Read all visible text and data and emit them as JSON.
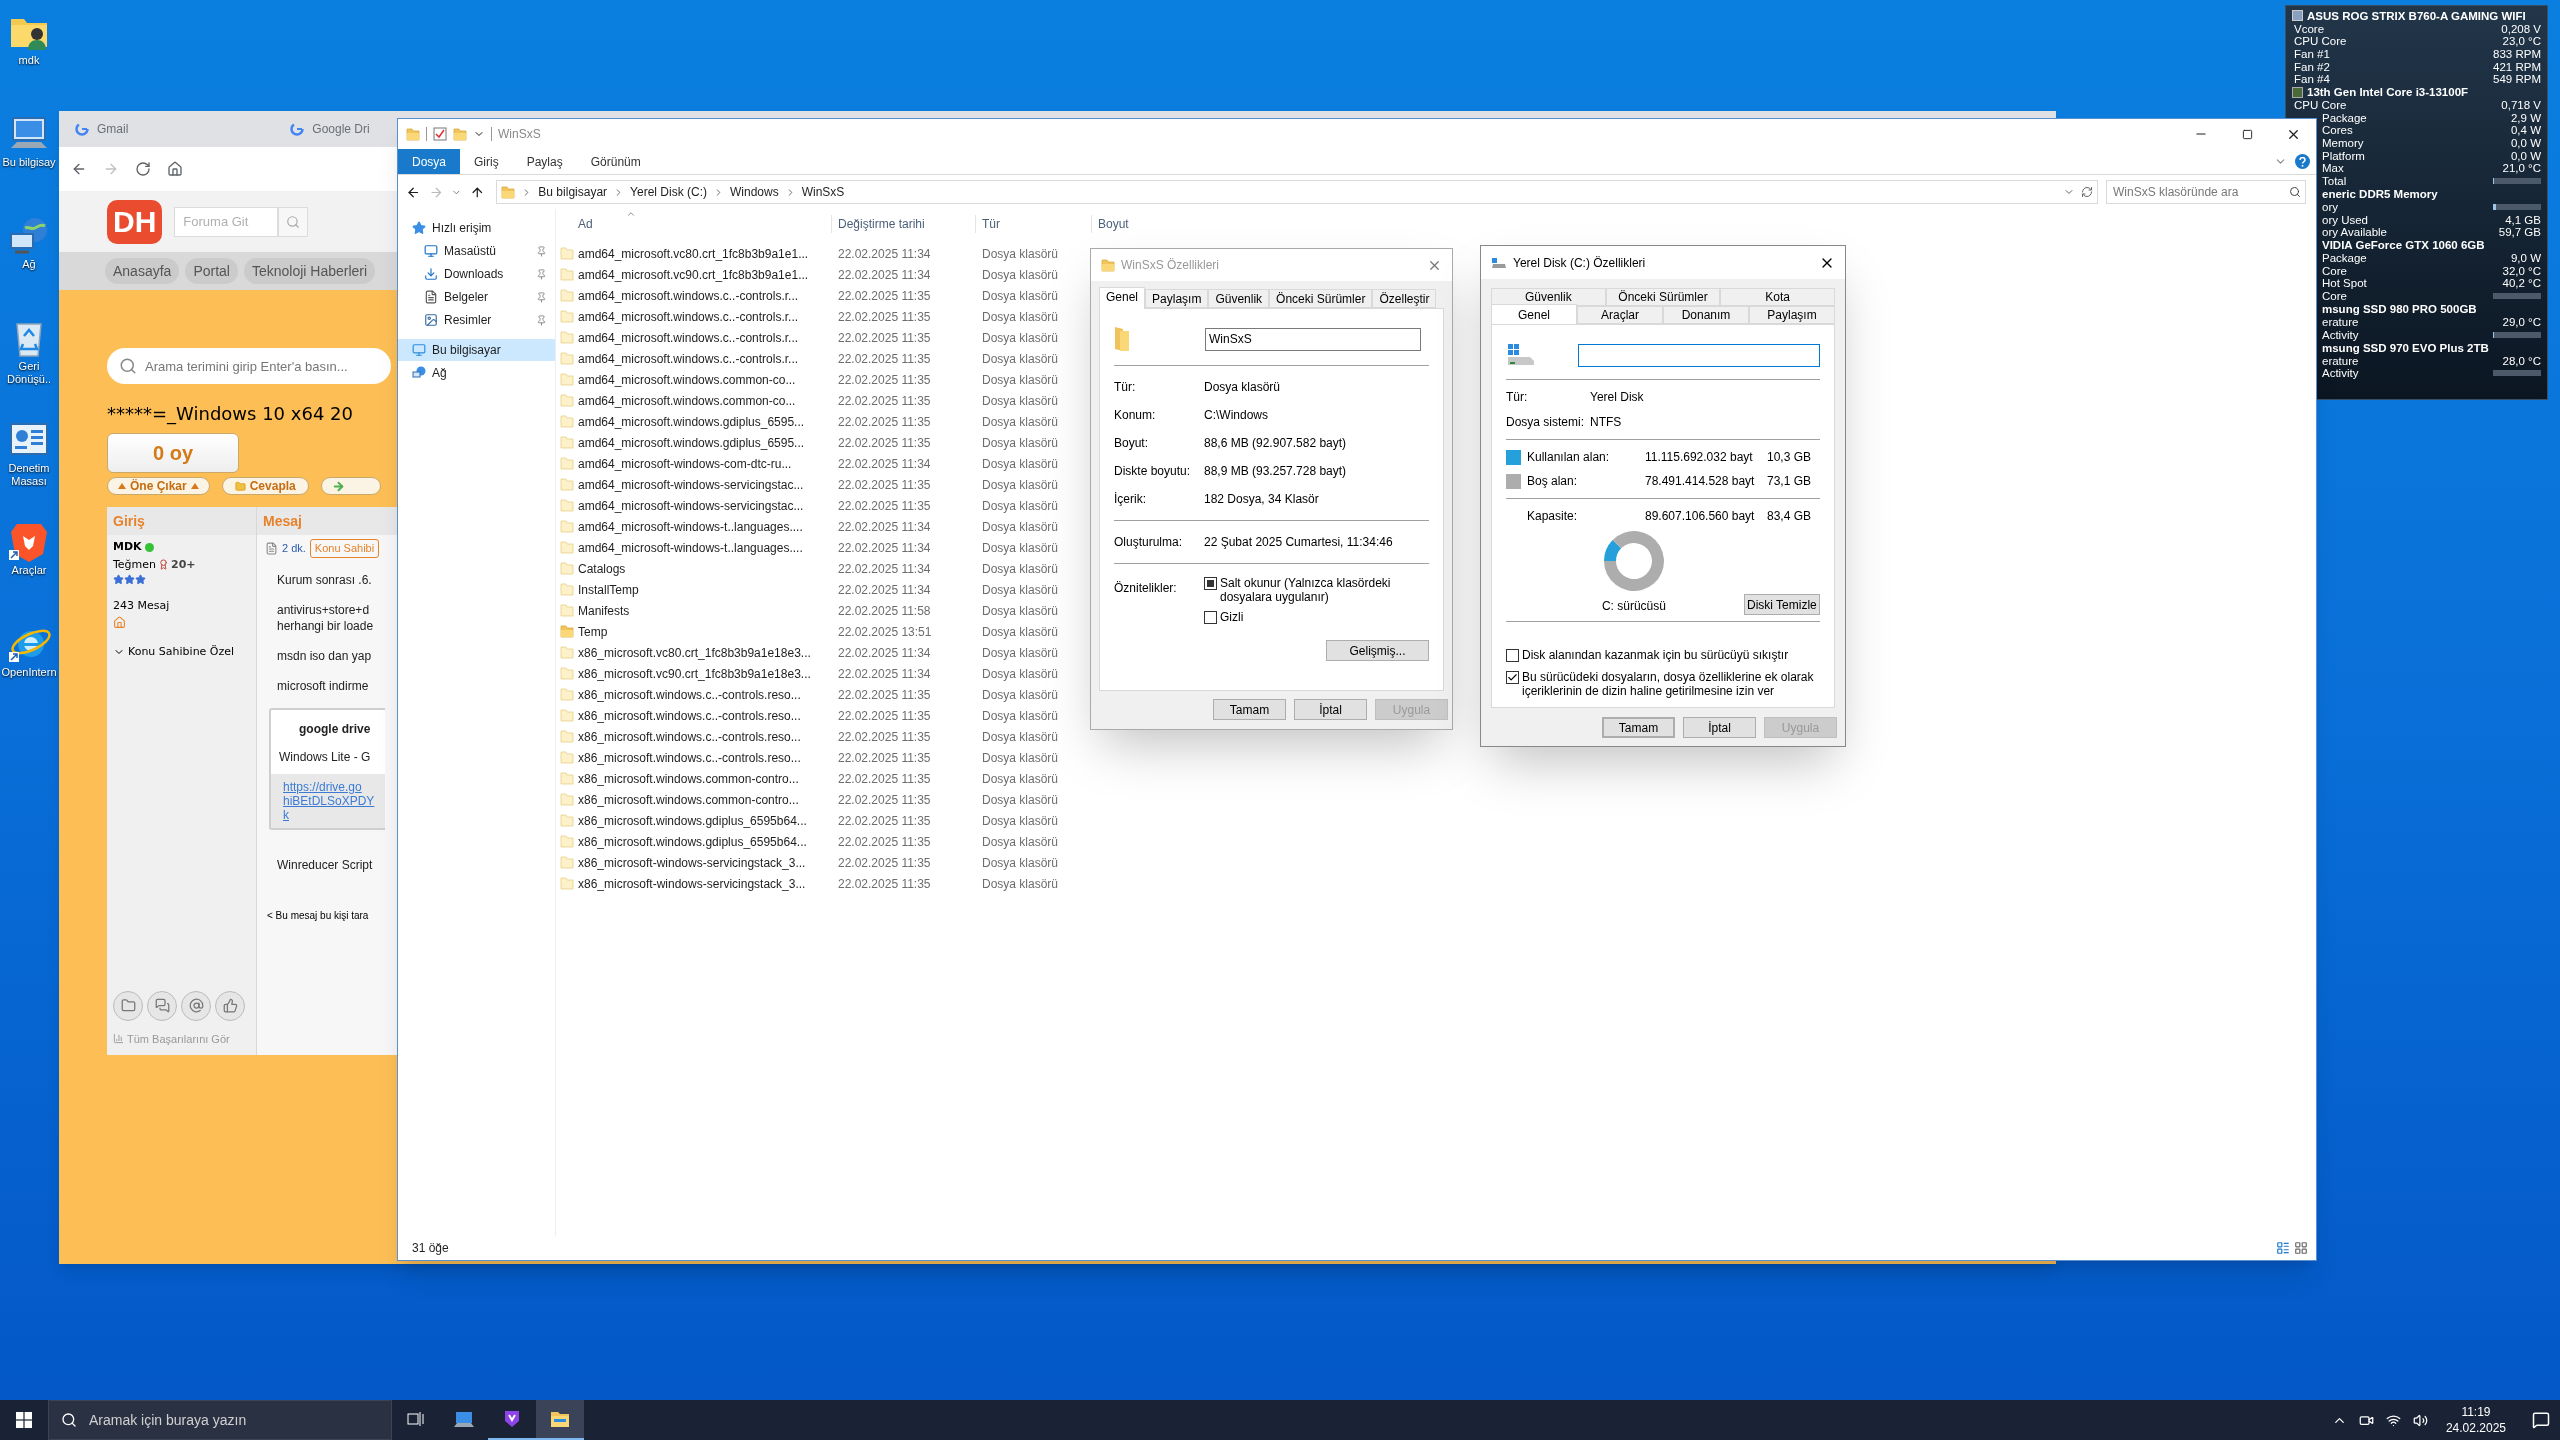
{
  "desktop_icons": [
    {
      "label": "mdk",
      "kind": "user-folder"
    },
    {
      "label": "Bu bilgisay",
      "kind": "computer"
    },
    {
      "label": "Ağ",
      "kind": "network"
    },
    {
      "label": "Geri Dönüşü..",
      "kind": "recycle"
    },
    {
      "label": "Denetim Masası",
      "kind": "control"
    },
    {
      "label": "Araçlar",
      "kind": "lion"
    },
    {
      "label": "OpenIntern",
      "kind": "globe-e"
    }
  ],
  "browser": {
    "tabs": [
      {
        "label": "Gmail"
      },
      {
        "label": "Google Dri"
      }
    ],
    "forum": {
      "logo": "DH",
      "search_placeholder": "Foruma Git",
      "nav": [
        "Anasayfa",
        "Portal",
        "Teknoloji Haberleri"
      ],
      "site_search_placeholder": "Arama terimini girip Enter'a basın...",
      "thread_title": "*****=_Windows 10 x64 20",
      "vote": "0 oy",
      "actions": [
        {
          "label": "Öne Çıkar",
          "kind": "promote"
        },
        {
          "label": "Cevapla",
          "kind": "reply"
        },
        {
          "kind": "forward"
        }
      ],
      "post": {
        "user_header": "Giriş",
        "message_header": "Mesaj",
        "user": {
          "name": "MDK",
          "online": true,
          "rank": "Teğmen",
          "rank_level": "20+",
          "stars": 3,
          "posts": "243 Mesaj",
          "menu": "Konu Sahibine Özel",
          "achievements": "Tüm Başarılarını Gör"
        },
        "message": {
          "time": "2 dk.",
          "badge": "Konu Sahibi",
          "paragraphs": [
            [
              "Kurum sonrası .6."
            ],
            [
              "antivirus+store+d",
              "herhangi bir loade"
            ],
            [
              "msdn iso dan yap"
            ],
            [
              "microsoft indirme"
            ]
          ],
          "quote": {
            "title": "google drive",
            "text": "Windows Lite - G",
            "link_lines": [
              "https://drive.go",
              "hiBEtDLSoXPDY",
              "k"
            ]
          },
          "after": "Winreducer Script",
          "footer": "< Bu mesaj bu kişi tara"
        }
      }
    }
  },
  "explorer": {
    "title": "WinSxS",
    "ribbon_tabs": [
      {
        "label": "Dosya",
        "selected": true
      },
      {
        "label": "Giriş",
        "selected": false
      },
      {
        "label": "Paylaş",
        "selected": false
      },
      {
        "label": "Görünüm",
        "selected": false
      }
    ],
    "path": [
      "Bu bilgisayar",
      "Yerel Disk (C:)",
      "Windows",
      "WinSxS"
    ],
    "search_placeholder": "WinSxS klasöründe ara",
    "nav": [
      {
        "label": "Hızlı erişim",
        "kind": "star",
        "selected": false,
        "children": [
          {
            "label": "Masaüstü",
            "kind": "desktop",
            "pinned": true,
            "selected": false
          },
          {
            "label": "Downloads",
            "kind": "download",
            "pinned": true,
            "selected": false
          },
          {
            "label": "Belgeler",
            "kind": "docs",
            "pinned": true,
            "selected": false
          },
          {
            "label": "Resimler",
            "kind": "pictures",
            "pinned": true,
            "selected": false
          }
        ]
      },
      {
        "label": "Bu bilgisayar",
        "kind": "pc",
        "selected": true
      },
      {
        "label": "Ağ",
        "kind": "network",
        "selected": false
      }
    ],
    "columns": [
      "Ad",
      "Değiştirme tarihi",
      "Tür",
      "Boyut"
    ],
    "rows": [
      {
        "name": "amd64_microsoft.vc80.crt_1fc8b3b9a1e1...",
        "date": "22.02.2025 11:34",
        "type": "Dosya klasörü",
        "kind": "empty-folder"
      },
      {
        "name": "amd64_microsoft.vc90.crt_1fc8b3b9a1e1...",
        "date": "22.02.2025 11:34",
        "type": "Dosya klasörü",
        "kind": "empty-folder"
      },
      {
        "name": "amd64_microsoft.windows.c..-controls.r...",
        "date": "22.02.2025 11:35",
        "type": "Dosya klasörü",
        "kind": "empty-folder"
      },
      {
        "name": "amd64_microsoft.windows.c..-controls.r...",
        "date": "22.02.2025 11:35",
        "type": "Dosya klasörü",
        "kind": "empty-folder"
      },
      {
        "name": "amd64_microsoft.windows.c..-controls.r...",
        "date": "22.02.2025 11:35",
        "type": "Dosya klasörü",
        "kind": "empty-folder"
      },
      {
        "name": "amd64_microsoft.windows.c..-controls.r...",
        "date": "22.02.2025 11:35",
        "type": "Dosya klasörü",
        "kind": "empty-folder"
      },
      {
        "name": "amd64_microsoft.windows.common-co...",
        "date": "22.02.2025 11:35",
        "type": "Dosya klasörü",
        "kind": "empty-folder"
      },
      {
        "name": "amd64_microsoft.windows.common-co...",
        "date": "22.02.2025 11:35",
        "type": "Dosya klasörü",
        "kind": "empty-folder"
      },
      {
        "name": "amd64_microsoft.windows.gdiplus_6595...",
        "date": "22.02.2025 11:35",
        "type": "Dosya klasörü",
        "kind": "empty-folder"
      },
      {
        "name": "amd64_microsoft.windows.gdiplus_6595...",
        "date": "22.02.2025 11:35",
        "type": "Dosya klasörü",
        "kind": "empty-folder"
      },
      {
        "name": "amd64_microsoft-windows-com-dtc-ru...",
        "date": "22.02.2025 11:34",
        "type": "Dosya klasörü",
        "kind": "empty-folder"
      },
      {
        "name": "amd64_microsoft-windows-servicingstac...",
        "date": "22.02.2025 11:35",
        "type": "Dosya klasörü",
        "kind": "empty-folder"
      },
      {
        "name": "amd64_microsoft-windows-servicingstac...",
        "date": "22.02.2025 11:35",
        "type": "Dosya klasörü",
        "kind": "empty-folder"
      },
      {
        "name": "amd64_microsoft-windows-t..languages....",
        "date": "22.02.2025 11:34",
        "type": "Dosya klasörü",
        "kind": "empty-folder"
      },
      {
        "name": "amd64_microsoft-windows-t..languages....",
        "date": "22.02.2025 11:34",
        "type": "Dosya klasörü",
        "kind": "empty-folder"
      },
      {
        "name": "Catalogs",
        "date": "22.02.2025 11:34",
        "type": "Dosya klasörü",
        "kind": "empty-folder"
      },
      {
        "name": "InstallTemp",
        "date": "22.02.2025 11:34",
        "type": "Dosya klasörü",
        "kind": "empty-folder"
      },
      {
        "name": "Manifests",
        "date": "22.02.2025 11:58",
        "type": "Dosya klasörü",
        "kind": "empty-folder"
      },
      {
        "name": "Temp",
        "date": "22.02.2025 13:51",
        "type": "Dosya klasörü",
        "kind": "folder"
      },
      {
        "name": "x86_microsoft.vc80.crt_1fc8b3b9a1e18e3...",
        "date": "22.02.2025 11:34",
        "type": "Dosya klasörü",
        "kind": "empty-folder"
      },
      {
        "name": "x86_microsoft.vc90.crt_1fc8b3b9a1e18e3...",
        "date": "22.02.2025 11:34",
        "type": "Dosya klasörü",
        "kind": "empty-folder"
      },
      {
        "name": "x86_microsoft.windows.c..-controls.reso...",
        "date": "22.02.2025 11:35",
        "type": "Dosya klasörü",
        "kind": "empty-folder"
      },
      {
        "name": "x86_microsoft.windows.c..-controls.reso...",
        "date": "22.02.2025 11:35",
        "type": "Dosya klasörü",
        "kind": "empty-folder"
      },
      {
        "name": "x86_microsoft.windows.c..-controls.reso...",
        "date": "22.02.2025 11:35",
        "type": "Dosya klasörü",
        "kind": "empty-folder"
      },
      {
        "name": "x86_microsoft.windows.c..-controls.reso...",
        "date": "22.02.2025 11:35",
        "type": "Dosya klasörü",
        "kind": "empty-folder"
      },
      {
        "name": "x86_microsoft.windows.common-contro...",
        "date": "22.02.2025 11:35",
        "type": "Dosya klasörü",
        "kind": "empty-folder"
      },
      {
        "name": "x86_microsoft.windows.common-contro...",
        "date": "22.02.2025 11:35",
        "type": "Dosya klasörü",
        "kind": "empty-folder"
      },
      {
        "name": "x86_microsoft.windows.gdiplus_6595b64...",
        "date": "22.02.2025 11:35",
        "type": "Dosya klasörü",
        "kind": "empty-folder"
      },
      {
        "name": "x86_microsoft.windows.gdiplus_6595b64...",
        "date": "22.02.2025 11:35",
        "type": "Dosya klasörü",
        "kind": "empty-folder"
      },
      {
        "name": "x86_microsoft-windows-servicingstack_3...",
        "date": "22.02.2025 11:35",
        "type": "Dosya klasörü",
        "kind": "empty-folder"
      },
      {
        "name": "x86_microsoft-windows-servicingstack_3...",
        "date": "22.02.2025 11:35",
        "type": "Dosya klasörü",
        "kind": "empty-folder"
      }
    ],
    "status": "31 öğe"
  },
  "folder_dialog": {
    "title": "WinSxS Özellikleri",
    "active": false,
    "tabs": [
      {
        "label": "Genel",
        "selected": true
      },
      {
        "label": "Paylaşım",
        "selected": false
      },
      {
        "label": "Güvenlik",
        "selected": false
      },
      {
        "label": "Önceki Sürümler",
        "selected": false
      },
      {
        "label": "Özelleştir",
        "selected": false
      }
    ],
    "name_value": "WinSxS",
    "groups": [
      [
        {
          "label": "Tür:",
          "value": "Dosya klasörü"
        },
        {
          "label": "Konum:",
          "value": "C:\\Windows"
        },
        {
          "label": "Boyut:",
          "value": "88,6 MB (92.907.582 bayt)"
        },
        {
          "label": "Diskte boyutu:",
          "value": "88,9 MB (93.257.728 bayt)"
        },
        {
          "label": "İçerik:",
          "value": "182 Dosya, 34 Klasör"
        }
      ],
      [
        {
          "label": "Oluşturulma:",
          "value": "22 Şubat 2025 Cumartesi, 11:34:46"
        }
      ]
    ],
    "attributes_label": "Öznitelikler:",
    "attributes": [
      {
        "label": "Salt okunur (Yalnızca klasördeki dosyalara uygulanır)",
        "checked": false,
        "indeterminate": true
      },
      {
        "label": "Gizli",
        "checked": false,
        "indeterminate": false
      }
    ],
    "advanced_button": "Gelişmiş...",
    "buttons": [
      {
        "label": "Tamam",
        "disabled": false,
        "default": false
      },
      {
        "label": "İptal",
        "disabled": false,
        "default": false
      },
      {
        "label": "Uygula",
        "disabled": true,
        "default": false
      }
    ]
  },
  "disk_dialog": {
    "title": "Yerel Disk (C:) Özellikleri",
    "active": true,
    "tab_rows": [
      [
        {
          "label": "Güvenlik",
          "selected": false
        },
        {
          "label": "Önceki Sürümler",
          "selected": false
        },
        {
          "label": "Kota",
          "selected": false
        }
      ],
      [
        {
          "label": "Genel",
          "selected": true
        },
        {
          "label": "Araçlar",
          "selected": false
        },
        {
          "label": "Donanım",
          "selected": false
        },
        {
          "label": "Paylaşım",
          "selected": false
        }
      ]
    ],
    "name_focused": true,
    "info": [
      {
        "label": "Tür:",
        "value": "Yerel Disk"
      },
      {
        "label": "Dosya sistemi:",
        "value": "NTFS"
      }
    ],
    "usage": [
      {
        "label": "Kullanılan alan:",
        "bytes": "11.115.692.032 bayt",
        "size": "10,3 GB",
        "color": "#26a0da"
      },
      {
        "label": "Boş alan:",
        "bytes": "78.491.414.528 bayt",
        "size": "73,1 GB",
        "color": "#adadad"
      }
    ],
    "capacity": {
      "label": "Kapasite:",
      "bytes": "89.607.106.560 bayt",
      "size": "83,4 GB"
    },
    "chart_data": {
      "type": "donut",
      "values": [
        12.4,
        87.6
      ]
    },
    "drive_label": "C: sürücüsü",
    "cleanup_button": "Diski Temizle",
    "options": [
      {
        "label": "Disk alanından kazanmak için bu sürücüyü sıkıştır",
        "checked": false
      },
      {
        "label": "Bu sürücüdeki dosyaların, dosya özelliklerine ek olarak içeriklerinin de dizin haline getirilmesine izin ver",
        "checked": true
      }
    ],
    "buttons": [
      {
        "label": "Tamam",
        "disabled": false,
        "default": true
      },
      {
        "label": "İptal",
        "disabled": false,
        "default": false
      },
      {
        "label": "Uygula",
        "disabled": true,
        "default": false
      }
    ]
  },
  "hwinfo": [
    {
      "title": "ASUS ROG STRIX B760-A GAMING WIFI",
      "cut": false,
      "kind": "board",
      "rows": [
        {
          "label": "Vcore",
          "value": "0,208 V",
          "cut": false,
          "kind": "value"
        },
        {
          "label": "CPU Core",
          "value": "23,0 °C",
          "cut": false,
          "kind": "value"
        },
        {
          "label": "Fan #1",
          "value": "833 RPM",
          "cut": false,
          "kind": "value"
        },
        {
          "label": "Fan #2",
          "value": "421 RPM",
          "cut": false,
          "kind": "value"
        },
        {
          "label": "Fan #4",
          "value": "549 RPM",
          "cut": false,
          "kind": "value"
        }
      ]
    },
    {
      "title": "13th Gen Intel Core i3-13100F",
      "cut": false,
      "kind": "chip",
      "rows": [
        {
          "label": "CPU Core",
          "value": "0,718 V",
          "cut": false,
          "kind": "value"
        },
        {
          "label": "Package",
          "value": "2,9 W",
          "cut": true,
          "kind": "value"
        },
        {
          "label": "Cores",
          "value": "0,4 W",
          "cut": true,
          "kind": "value"
        },
        {
          "label": "Memory",
          "value": "0,0 W",
          "cut": true,
          "kind": "value"
        },
        {
          "label": "Platform",
          "value": "0,0 W",
          "cut": true,
          "kind": "value"
        },
        {
          "label": "Max",
          "value": "21,0 °C",
          "cut": true,
          "kind": "value"
        },
        {
          "label": "Total",
          "level": 0.03,
          "cut": true,
          "kind": "bar"
        }
      ]
    },
    {
      "title": "eneric DDR5 Memory",
      "cut": true,
      "kind": "none",
      "rows": [
        {
          "label": "ory",
          "level": 0.07,
          "cut": true,
          "kind": "bar"
        },
        {
          "label": "ory Used",
          "value": "4,1 GB",
          "cut": true,
          "kind": "value"
        },
        {
          "label": "ory Available",
          "value": "59,7 GB",
          "cut": true,
          "kind": "value"
        }
      ]
    },
    {
      "title": "VIDIA GeForce GTX 1060 6GB",
      "cut": true,
      "kind": "none",
      "rows": [
        {
          "label": "Package",
          "value": "9,0 W",
          "cut": true,
          "kind": "value"
        },
        {
          "label": "Core",
          "value": "32,0 °C",
          "cut": true,
          "kind": "value"
        },
        {
          "label": "Hot Spot",
          "value": "40,2 °C",
          "cut": true,
          "kind": "value"
        },
        {
          "label": "Core",
          "level": 0,
          "cut": true,
          "kind": "bar"
        }
      ]
    },
    {
      "title": "msung SSD 980 PRO 500GB",
      "cut": true,
      "kind": "none",
      "rows": [
        {
          "label": "erature",
          "value": "29,0 °C",
          "cut": true,
          "kind": "value"
        },
        {
          "label": "Activity",
          "level": 0.02,
          "cut": true,
          "kind": "bar"
        }
      ]
    },
    {
      "title": "msung SSD 970 EVO Plus 2TB",
      "cut": true,
      "kind": "none",
      "rows": [
        {
          "label": "erature",
          "value": "28,0 °C",
          "cut": true,
          "kind": "value"
        },
        {
          "label": "Activity",
          "level": 0,
          "cut": true,
          "kind": "bar"
        }
      ]
    }
  ],
  "taskbar": {
    "search_placeholder": "Aramak için buraya yazın",
    "apps": [
      {
        "kind": "taskview",
        "running": false,
        "active": false
      },
      {
        "kind": "monitor-app",
        "running": false,
        "active": false
      },
      {
        "kind": "purple-app",
        "running": true,
        "active": false
      },
      {
        "kind": "explorer",
        "running": true,
        "active": true
      }
    ],
    "time": "11:19",
    "date": "24.02.2025"
  }
}
